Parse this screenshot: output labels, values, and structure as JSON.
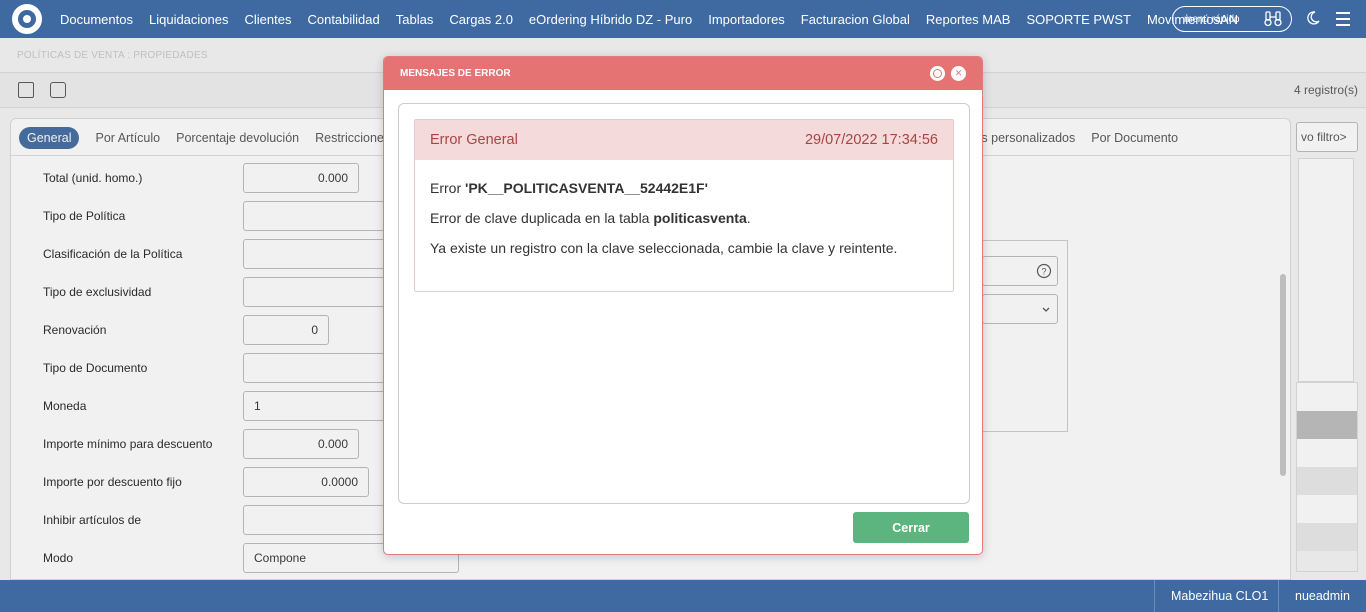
{
  "nav": {
    "items": [
      "Documentos",
      "Liquidaciones",
      "Clientes",
      "Contabilidad",
      "Tablas",
      "Cargas 2.0",
      "eOrdering Híbrido DZ - Puro",
      "Importadores",
      "Facturacion Global",
      "Reportes MAB",
      "SOPORTE PWST",
      "MovimientosAN"
    ],
    "quick_menu_label": "menú rápido"
  },
  "page": {
    "breadcrumb": "POLÍTICAS DE VENTA : PROPIEDADES",
    "records_text": "4 registro(s)",
    "filter_label": "vo filtro>",
    "tabs": [
      "General",
      "Por Artículo",
      "Porcentaje devolución",
      "Restricciones po"
    ],
    "tabs_right": [
      "tos personalizados",
      "Por Documento"
    ],
    "form": [
      {
        "label": "Total (unid. homo.)",
        "value": "0.000"
      },
      {
        "label": "Tipo de Política",
        "value": ""
      },
      {
        "label": "Clasificación de la Política",
        "value": ""
      },
      {
        "label": "Tipo de exclusividad",
        "value": ""
      },
      {
        "label": "Renovación",
        "value": "0"
      },
      {
        "label": "Tipo de Documento",
        "value": ""
      },
      {
        "label": "Moneda",
        "value": "1"
      },
      {
        "label": "Importe mínimo para descuento",
        "value": "0.000"
      },
      {
        "label": "Importe por descuento fijo",
        "value": "0.0000"
      },
      {
        "label": "Inhibir artículos de",
        "value": ""
      },
      {
        "label": "Modo",
        "value": "Compone"
      }
    ]
  },
  "modal": {
    "title": "MENSAJES DE ERROR",
    "error_title": "Error General",
    "timestamp": "29/07/2022 17:34:56",
    "line1_prefix": "Error ",
    "line1_code": "'PK__POLITICASVENTA__52442E1F'",
    "line2_prefix": "Error de clave duplicada en la tabla ",
    "line2_table": "politicasventa",
    "line2_suffix": ".",
    "line3": "Ya existe un registro con la clave seleccionada, cambie la clave y reintente.",
    "close_button": "Cerrar"
  },
  "status": {
    "company": "Mabezihua CLO1",
    "user": "nueadmin"
  },
  "colors": {
    "topbar": "#3f6aa1",
    "modal_header": "#e57373",
    "error_header_bg": "#f4dada",
    "close_button": "#5cb57f"
  }
}
